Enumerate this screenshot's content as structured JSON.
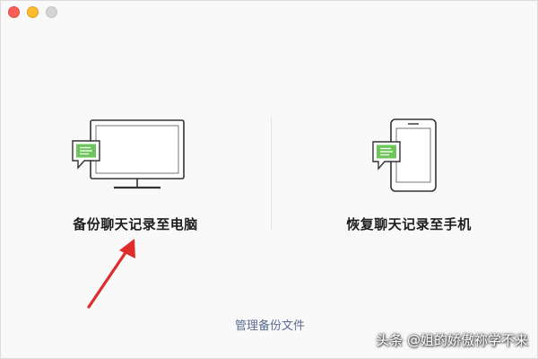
{
  "window": {
    "controls": [
      "close",
      "minimize",
      "maximize"
    ]
  },
  "options": {
    "backup_label": "备份聊天记录至电脑",
    "restore_label": "恢复聊天记录至手机",
    "backup_icon": "monitor-chat-icon",
    "restore_icon": "phone-chat-icon"
  },
  "footer": {
    "manage_link": "管理备份文件"
  },
  "annotation": {
    "arrow_color": "#e02b2b",
    "arrow_icon": "red-arrow-icon"
  },
  "watermark": {
    "text": "头条 @姐的娇傲祢学不来"
  },
  "colors": {
    "accent_green": "#6dc65a",
    "link": "#5a6c93",
    "close": "#fb5e56",
    "minimize": "#fcbc2e",
    "maximize": "#d4d4d4"
  }
}
